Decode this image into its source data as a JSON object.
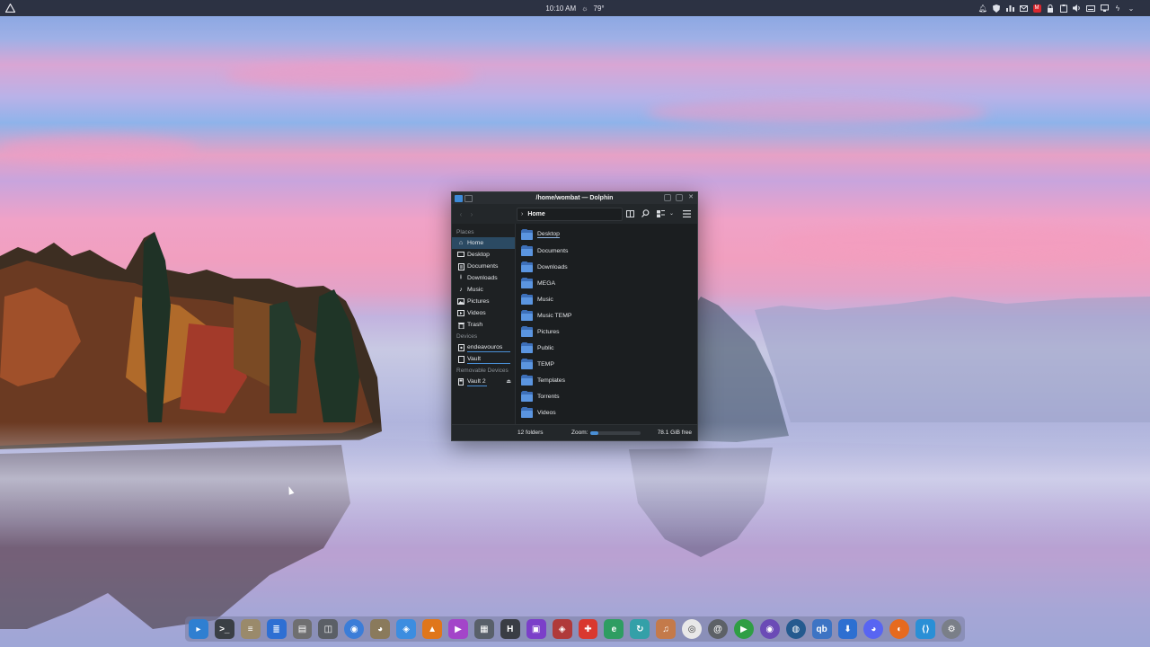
{
  "panel": {
    "time": "10:10 AM",
    "weather_icon": "sun-icon",
    "temperature": "79°",
    "tray_icons": [
      "bell-icon",
      "shield-icon",
      "bar-chart-icon",
      "mail-icon",
      "mega-icon",
      "lock-icon",
      "clipboard-icon",
      "volume-icon",
      "keyboard-icon",
      "display-icon",
      "battery-icon",
      "chevron-down-icon"
    ]
  },
  "window": {
    "title": "/home/wombat — Dolphin",
    "breadcrumb": "Home",
    "places_heading": "Places",
    "places": [
      {
        "label": "Home",
        "icon": "home-icon"
      },
      {
        "label": "Desktop",
        "icon": "monitor-icon"
      },
      {
        "label": "Documents",
        "icon": "document-icon"
      },
      {
        "label": "Downloads",
        "icon": "download-icon"
      },
      {
        "label": "Music",
        "icon": "music-icon"
      },
      {
        "label": "Pictures",
        "icon": "picture-icon"
      },
      {
        "label": "Videos",
        "icon": "video-icon"
      },
      {
        "label": "Trash",
        "icon": "trash-icon"
      }
    ],
    "devices_heading": "Devices",
    "devices": [
      {
        "label": "endeavouros",
        "icon": "drive-icon"
      },
      {
        "label": "Vault",
        "icon": "drive-icon"
      }
    ],
    "removable_heading": "Removable Devices",
    "removable": [
      {
        "label": "Vault 2",
        "icon": "usb-drive-icon"
      }
    ],
    "folders": [
      "Desktop",
      "Documents",
      "Downloads",
      "MEGA",
      "Music",
      "Music TEMP",
      "Pictures",
      "Public",
      "TEMP",
      "Templates",
      "Torrents",
      "Videos"
    ],
    "status": {
      "count": "12 folders",
      "zoom_label": "Zoom:",
      "zoom_level": 0.15,
      "free_space": "78.1 GiB free"
    }
  },
  "dock": {
    "apps": [
      {
        "name": "dolphin",
        "color": "#2f7fd1"
      },
      {
        "name": "terminal",
        "color": "#3a3f45"
      },
      {
        "name": "notes",
        "color": "#9a8a6b"
      },
      {
        "name": "writer",
        "color": "#2e6fd3"
      },
      {
        "name": "document-viewer",
        "color": "#6f6f70"
      },
      {
        "name": "screenshot",
        "color": "#5b5f66"
      },
      {
        "name": "chrome",
        "color": "#3b7dd8"
      },
      {
        "name": "gimp",
        "color": "#8a7a5c"
      },
      {
        "name": "vpn",
        "color": "#3c8de0"
      },
      {
        "name": "vlc",
        "color": "#e0761a"
      },
      {
        "name": "video-player",
        "color": "#a345c9"
      },
      {
        "name": "calendar",
        "color": "#59606a"
      },
      {
        "name": "heading",
        "color": "#3a3d44"
      },
      {
        "name": "kdenlive",
        "color": "#7b3fc9"
      },
      {
        "name": "audio-editor",
        "color": "#b03a3a"
      },
      {
        "name": "first-aid",
        "color": "#d9382f"
      },
      {
        "name": "edge",
        "color": "#2e9d62"
      },
      {
        "name": "sync",
        "color": "#33a0a8"
      },
      {
        "name": "music-app",
        "color": "#c47a4a"
      },
      {
        "name": "disc",
        "color": "#e8e8e8"
      },
      {
        "name": "mail-at",
        "color": "#5d6167"
      },
      {
        "name": "play",
        "color": "#2f9e44"
      },
      {
        "name": "media",
        "color": "#6b4bb6"
      },
      {
        "name": "steam",
        "color": "#245a8f"
      },
      {
        "name": "qbittorrent",
        "color": "#3d74c4"
      },
      {
        "name": "downloader",
        "color": "#2d6fd1"
      },
      {
        "name": "discord",
        "color": "#5865f2"
      },
      {
        "name": "firefox",
        "color": "#e66a1f"
      },
      {
        "name": "vscode",
        "color": "#2a8fd6"
      },
      {
        "name": "settings",
        "color": "#7a7f88"
      }
    ]
  }
}
